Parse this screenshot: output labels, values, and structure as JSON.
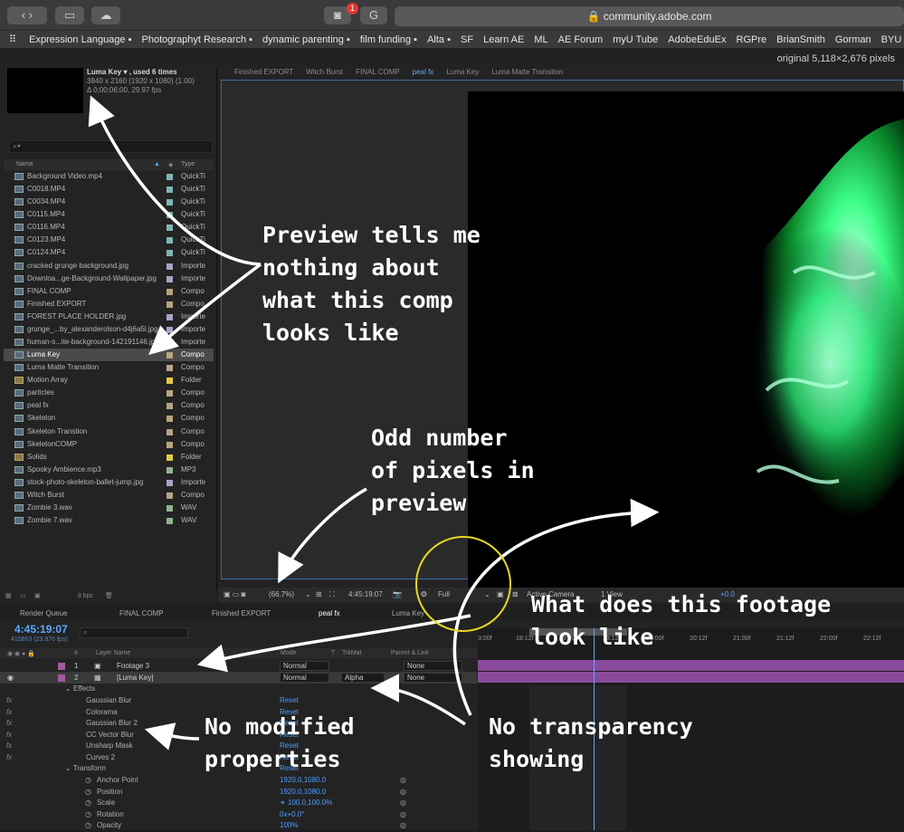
{
  "browser": {
    "url": "community.adobe.com",
    "notification_count": "1",
    "bookmarks": [
      "Expression Language ▪",
      "Photographyt Research ▪",
      "dynamic parenting ▪",
      "film funding ▪",
      "Alta ▪",
      "SF",
      "Learn AE",
      "ML",
      "AE Forum",
      "myU Tube",
      "AdobeEduEx",
      "RGPre",
      "BrianSmith",
      "Gorman",
      "BYU"
    ],
    "image_info": "original 5,118×2,676 pixels"
  },
  "project": {
    "comp_name": "Luma Key ▾ , used 6 times",
    "comp_dims": "3840 x 2160  (1920 x 1080) (1.00)",
    "comp_duration": "Δ 0;00;06;00, 29.97 fps",
    "search_placeholder": "⌕▾",
    "col_name": "Name",
    "col_type": "Type",
    "items": [
      {
        "name": "Background Video.mp4",
        "type": "QuickTi",
        "label": "#7fb5b5",
        "folder": false
      },
      {
        "name": "C0018.MP4",
        "type": "QuickTi",
        "label": "#7fb5b5",
        "folder": false
      },
      {
        "name": "C0034.MP4",
        "type": "QuickTi",
        "label": "#7fb5b5",
        "folder": false
      },
      {
        "name": "C0115.MP4",
        "type": "QuickTi",
        "label": "#7fb5b5",
        "folder": false
      },
      {
        "name": "C0116.MP4",
        "type": "QuickTi",
        "label": "#7fb5b5",
        "folder": false
      },
      {
        "name": "C0123.MP4",
        "type": "QuickTi",
        "label": "#7fb5b5",
        "folder": false
      },
      {
        "name": "C0124.MP4",
        "type": "QuickTi",
        "label": "#7fb5b5",
        "folder": false
      },
      {
        "name": "cracked grunge background.jpg",
        "type": "Importe",
        "label": "#a9a3c9",
        "folder": false
      },
      {
        "name": "Downloa...ge-Background-Wallpaper.jpg",
        "type": "Importe",
        "label": "#a9a3c9",
        "folder": false
      },
      {
        "name": "FINAL COMP",
        "type": "Compo",
        "label": "#b8a57f",
        "folder": false
      },
      {
        "name": "Finished EXPORT",
        "type": "Compo",
        "label": "#b8a57f",
        "folder": false
      },
      {
        "name": "FOREST PLACE HOLDER.jpg",
        "type": "Importe",
        "label": "#a9a3c9",
        "folder": false
      },
      {
        "name": "grunge_...by_alexanderolson-d4j6a5l.jpg",
        "type": "Importe",
        "label": "#a9a3c9",
        "folder": false
      },
      {
        "name": "human-s...ite-background-142191146.jpg",
        "type": "Importe",
        "label": "#a9a3c9",
        "folder": false
      },
      {
        "name": "Luma Key",
        "type": "Compo",
        "label": "#b8a57f",
        "folder": false,
        "selected": true
      },
      {
        "name": "Luma Matte Transition",
        "type": "Compo",
        "label": "#b8a57f",
        "folder": false
      },
      {
        "name": "Motion Array",
        "type": "Folder",
        "label": "#e3c94a",
        "folder": true
      },
      {
        "name": "particles",
        "type": "Compo",
        "label": "#b8a57f",
        "folder": false
      },
      {
        "name": "peal fx",
        "type": "Compo",
        "label": "#b8a57f",
        "folder": false
      },
      {
        "name": "Skeleton",
        "type": "Compo",
        "label": "#b8a57f",
        "folder": false
      },
      {
        "name": "Skeleton Transtion",
        "type": "Compo",
        "label": "#b8a57f",
        "folder": false
      },
      {
        "name": "SkeletonCOMP",
        "type": "Compo",
        "label": "#b8a57f",
        "folder": false
      },
      {
        "name": "Solids",
        "type": "Folder",
        "label": "#e3c94a",
        "folder": true
      },
      {
        "name": "Spooky Ambience.mp3",
        "type": "MP3",
        "label": "#8fb58f",
        "folder": false
      },
      {
        "name": "stock-photo-skeleton-ballet-jump.jpg",
        "type": "Importe",
        "label": "#a9a3c9",
        "folder": false
      },
      {
        "name": "Witch Burst",
        "type": "Compo",
        "label": "#b8a57f",
        "folder": false
      },
      {
        "name": "Zombie 3.wav",
        "type": "WAV",
        "label": "#8fb58f",
        "folder": false
      },
      {
        "name": "Zombie 7.wav",
        "type": "WAV",
        "label": "#8fb58f",
        "folder": false
      }
    ],
    "bpc": "8 bpc"
  },
  "composition": {
    "breadcrumbs": [
      "Finished EXPORT",
      "Witch Burst",
      "FINAL COMP",
      "peal fx",
      "Luma Key",
      "Luma Matte Transition"
    ],
    "zoom": "(66.7%)",
    "timecode": "4:45:19:07",
    "resolution": "Full",
    "camera": "Active Camera",
    "views": "1 View",
    "exposure": "+0.0"
  },
  "timeline": {
    "tabs": [
      "Render Queue",
      "FINAL COMP",
      "Finished EXPORT",
      "peal fx",
      "Luma Key"
    ],
    "timecode": "4:45:19:07",
    "fps": "410863 (23.976 fps)",
    "headers": {
      "layer_name": "Layer Name",
      "mode": "Mode",
      "t": "T",
      "trkmat": "TrkMat",
      "parent": "Parent & Link"
    },
    "layers": [
      {
        "num": "1",
        "name": "Footage 3",
        "mode": "Normal",
        "trkmat": "",
        "parent": "None"
      },
      {
        "num": "2",
        "name": "[Luma Key]",
        "mode": "Normal",
        "trkmat": "Alpha",
        "parent": "None"
      }
    ],
    "effects_label": "Effects",
    "effects": [
      "Gaussian Blur",
      "Colorama",
      "Gaussian Blur 2",
      "CC Vector Blur",
      "Unsharp Mask",
      "Curves 2"
    ],
    "reset_label": "Reset",
    "transform_label": "Transform",
    "transform": [
      {
        "name": "Anchor Point",
        "value": "1920.0,1080.0"
      },
      {
        "name": "Position",
        "value": "1920.0,1080.0"
      },
      {
        "name": "Scale",
        "value": "⚭ 100.0,100.0%"
      },
      {
        "name": "Rotation",
        "value": "0x+0.0°"
      },
      {
        "name": "Opacity",
        "value": "100%"
      }
    ],
    "ruler": [
      "3:00f",
      "18:12f",
      "19:00f",
      "19:12f",
      "20:00f",
      "20:12f",
      "21:00f",
      "21:12f",
      "22:00f",
      "22:12f"
    ]
  },
  "annotations": {
    "preview": "Preview tells me\nnothing about\nwhat this comp\nlooks like",
    "odd_pixels": "Odd number\nof pixels in\npreview",
    "footage": "What does this footage\nlook like",
    "no_modified": "No modified\nproperties",
    "no_transparency": "No transparency\nshowing"
  },
  "colors": {
    "accent": "#5da8ff",
    "annotation": "#ffffff",
    "highlight_circle": "#e8d820"
  }
}
